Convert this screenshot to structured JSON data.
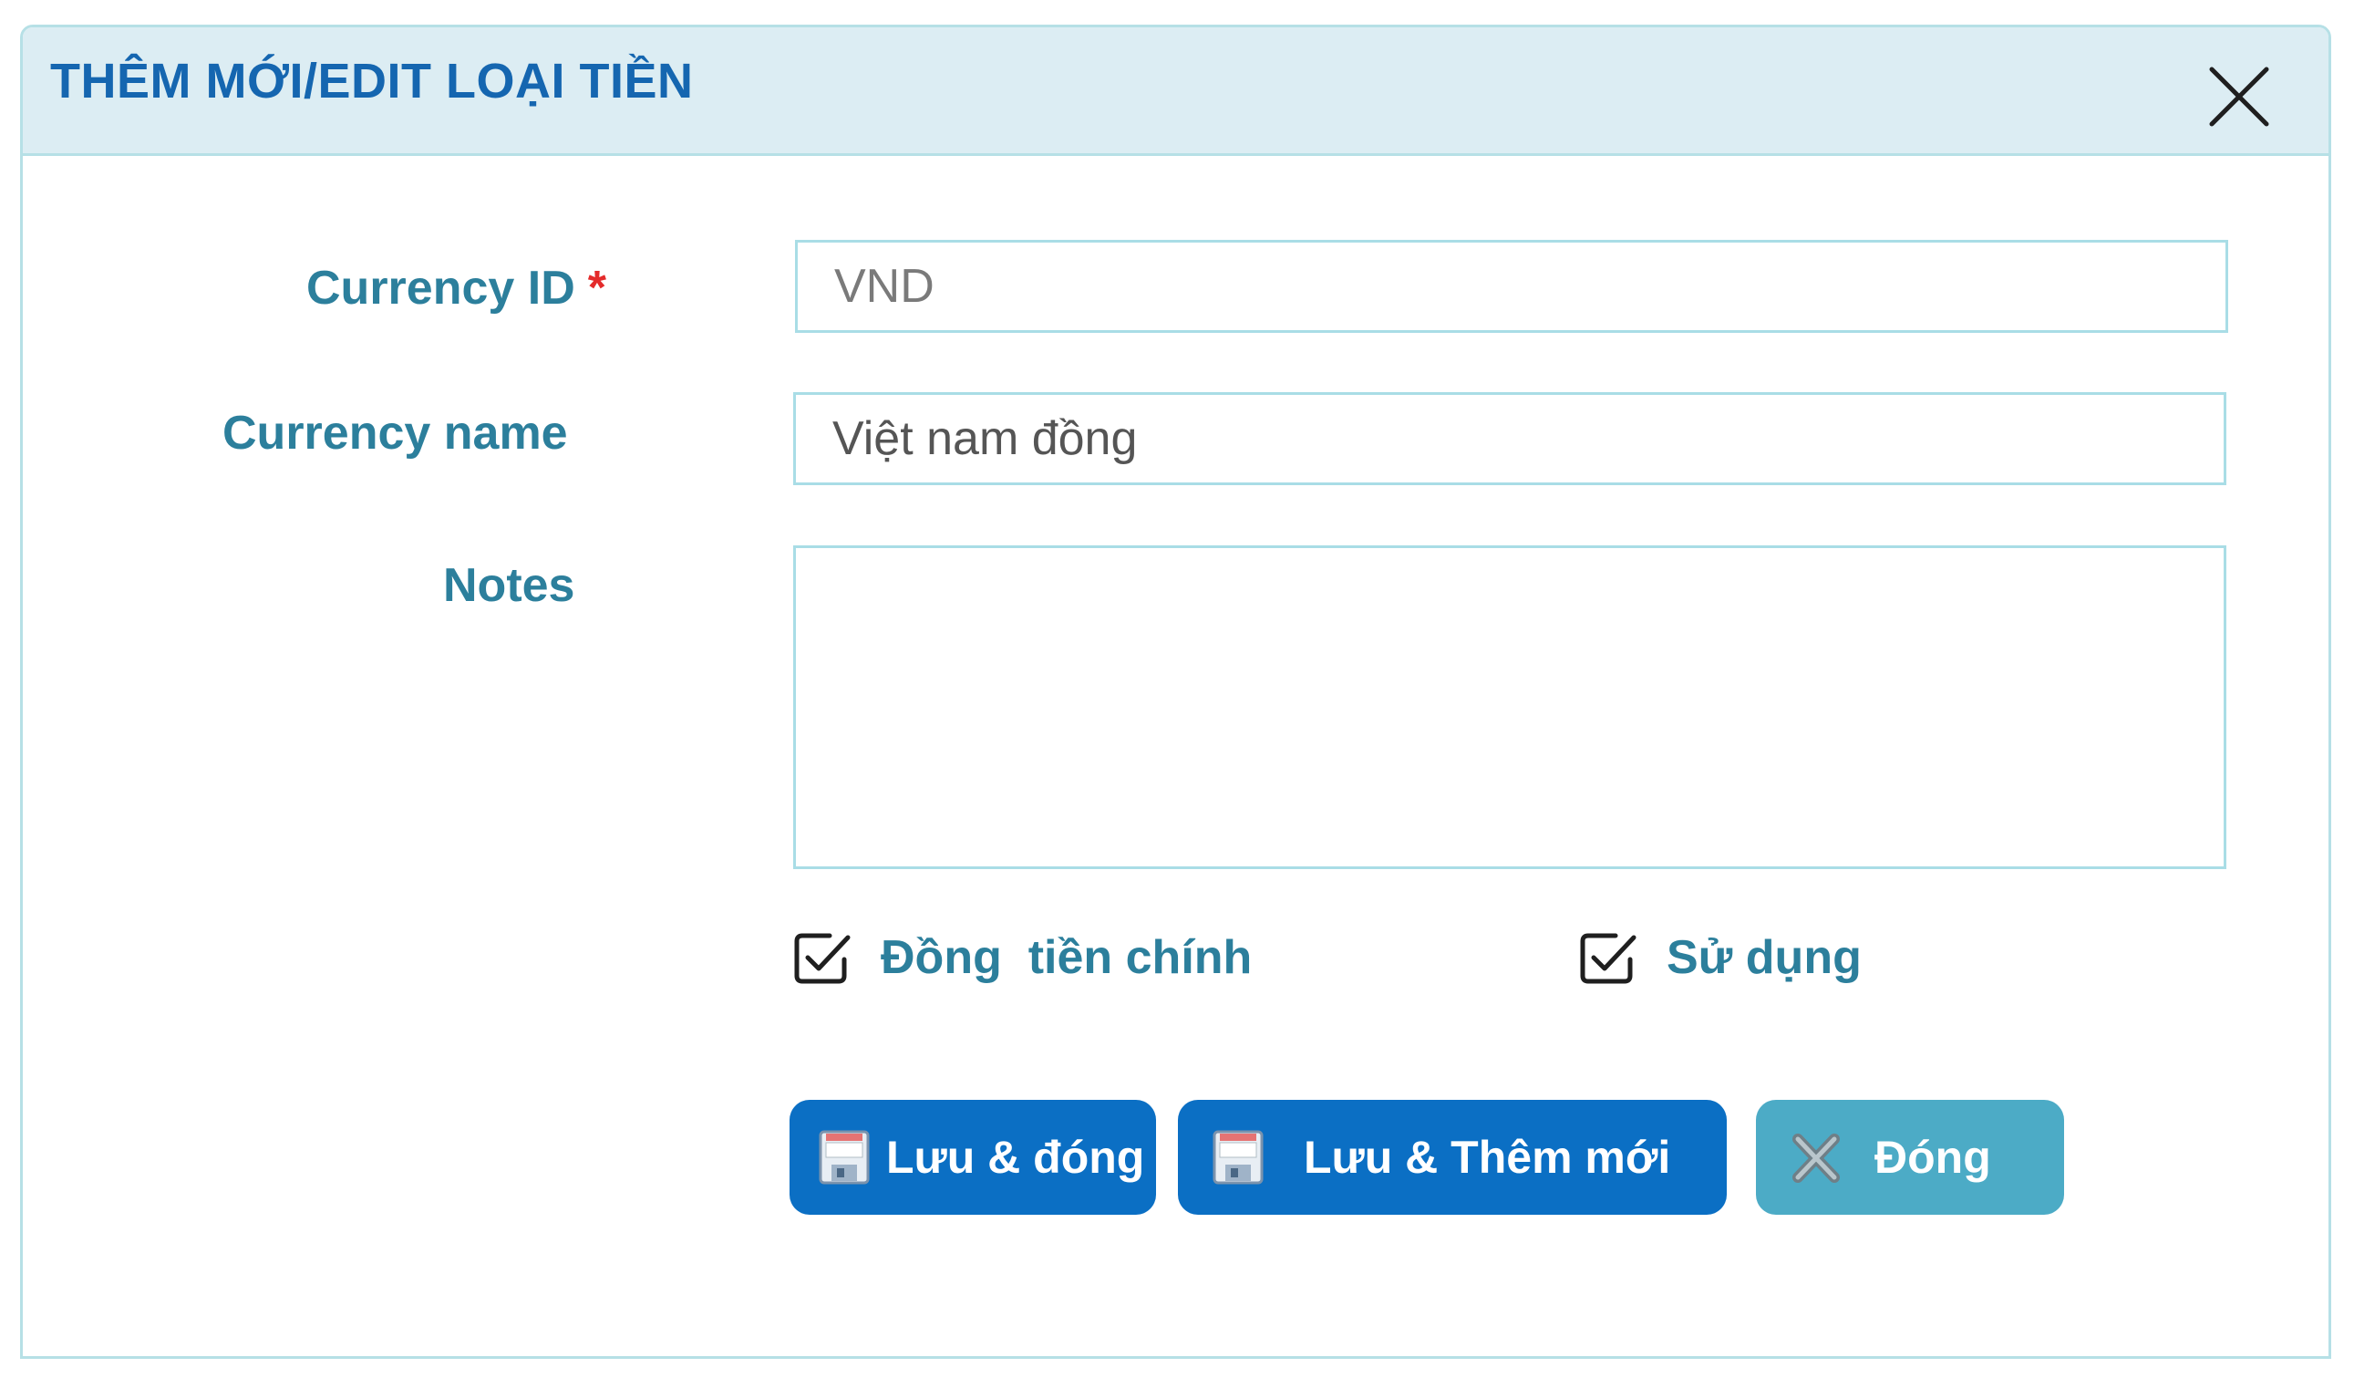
{
  "dialog": {
    "title": "THÊM MỚI/EDIT LOẠI TIỀN",
    "close_icon": "close-icon"
  },
  "form": {
    "currency_id": {
      "label": "Currency ID",
      "required_marker": "*",
      "value": "VND"
    },
    "currency_name": {
      "label": "Currency name",
      "value": "Việt nam đồng"
    },
    "notes": {
      "label": "Notes",
      "value": ""
    },
    "checkboxes": [
      {
        "label": "Đồng  tiền chính",
        "checked": true,
        "icon": "checkbox-checked-icon"
      },
      {
        "label": "Sử dụng",
        "checked": true,
        "icon": "checkbox-checked-icon"
      }
    ]
  },
  "buttons": {
    "save_close": {
      "label": "Lưu & đóng",
      "icon": "floppy-disk-icon"
    },
    "save_new": {
      "label": "Lưu & Thêm mới",
      "icon": "floppy-disk-icon"
    },
    "close": {
      "label": "Đóng",
      "icon": "x-icon"
    }
  },
  "colors": {
    "header_bg": "#dcedf3",
    "title": "#1566b0",
    "label": "#2c7f9c",
    "required": "#e42b2b",
    "primary_button": "#0b6fc4",
    "secondary_button": "#4cabc6",
    "field_border": "#a9dde6"
  }
}
